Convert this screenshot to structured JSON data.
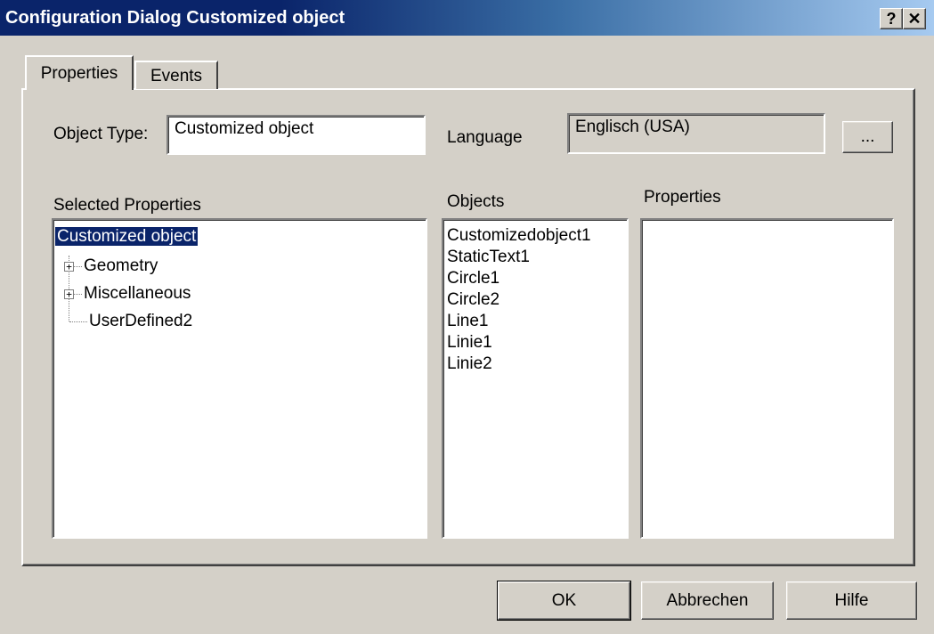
{
  "window": {
    "title": "Configuration Dialog Customized object",
    "help_glyph": "?",
    "close_glyph": "✕"
  },
  "tabs": [
    {
      "label": "Properties",
      "active": true
    },
    {
      "label": "Events",
      "active": false
    }
  ],
  "object_type": {
    "label": "Object Type:",
    "value": "Customized object"
  },
  "language": {
    "label": "Language",
    "value": "Englisch (USA)",
    "browse_label": "..."
  },
  "selected_properties": {
    "header": "Selected Properties",
    "root": "Customized object",
    "nodes": [
      {
        "label": "Geometry",
        "expandable": true
      },
      {
        "label": "Miscellaneous",
        "expandable": true
      },
      {
        "label": "UserDefined2",
        "expandable": false
      }
    ],
    "expand_glyph": "+"
  },
  "objects": {
    "header": "Objects",
    "items": [
      "Customizedobject1",
      "StaticText1",
      "Circle1",
      "Circle2",
      "Line1",
      "Linie1",
      "Linie2"
    ]
  },
  "properties": {
    "header": "Properties",
    "items": []
  },
  "buttons": {
    "ok": "OK",
    "cancel": "Abbrechen",
    "help": "Hilfe"
  },
  "colors": {
    "titlebar_start": "#0a246a",
    "titlebar_end": "#a6caf0",
    "face": "#d4d0c8",
    "selection": "#0a246a"
  }
}
